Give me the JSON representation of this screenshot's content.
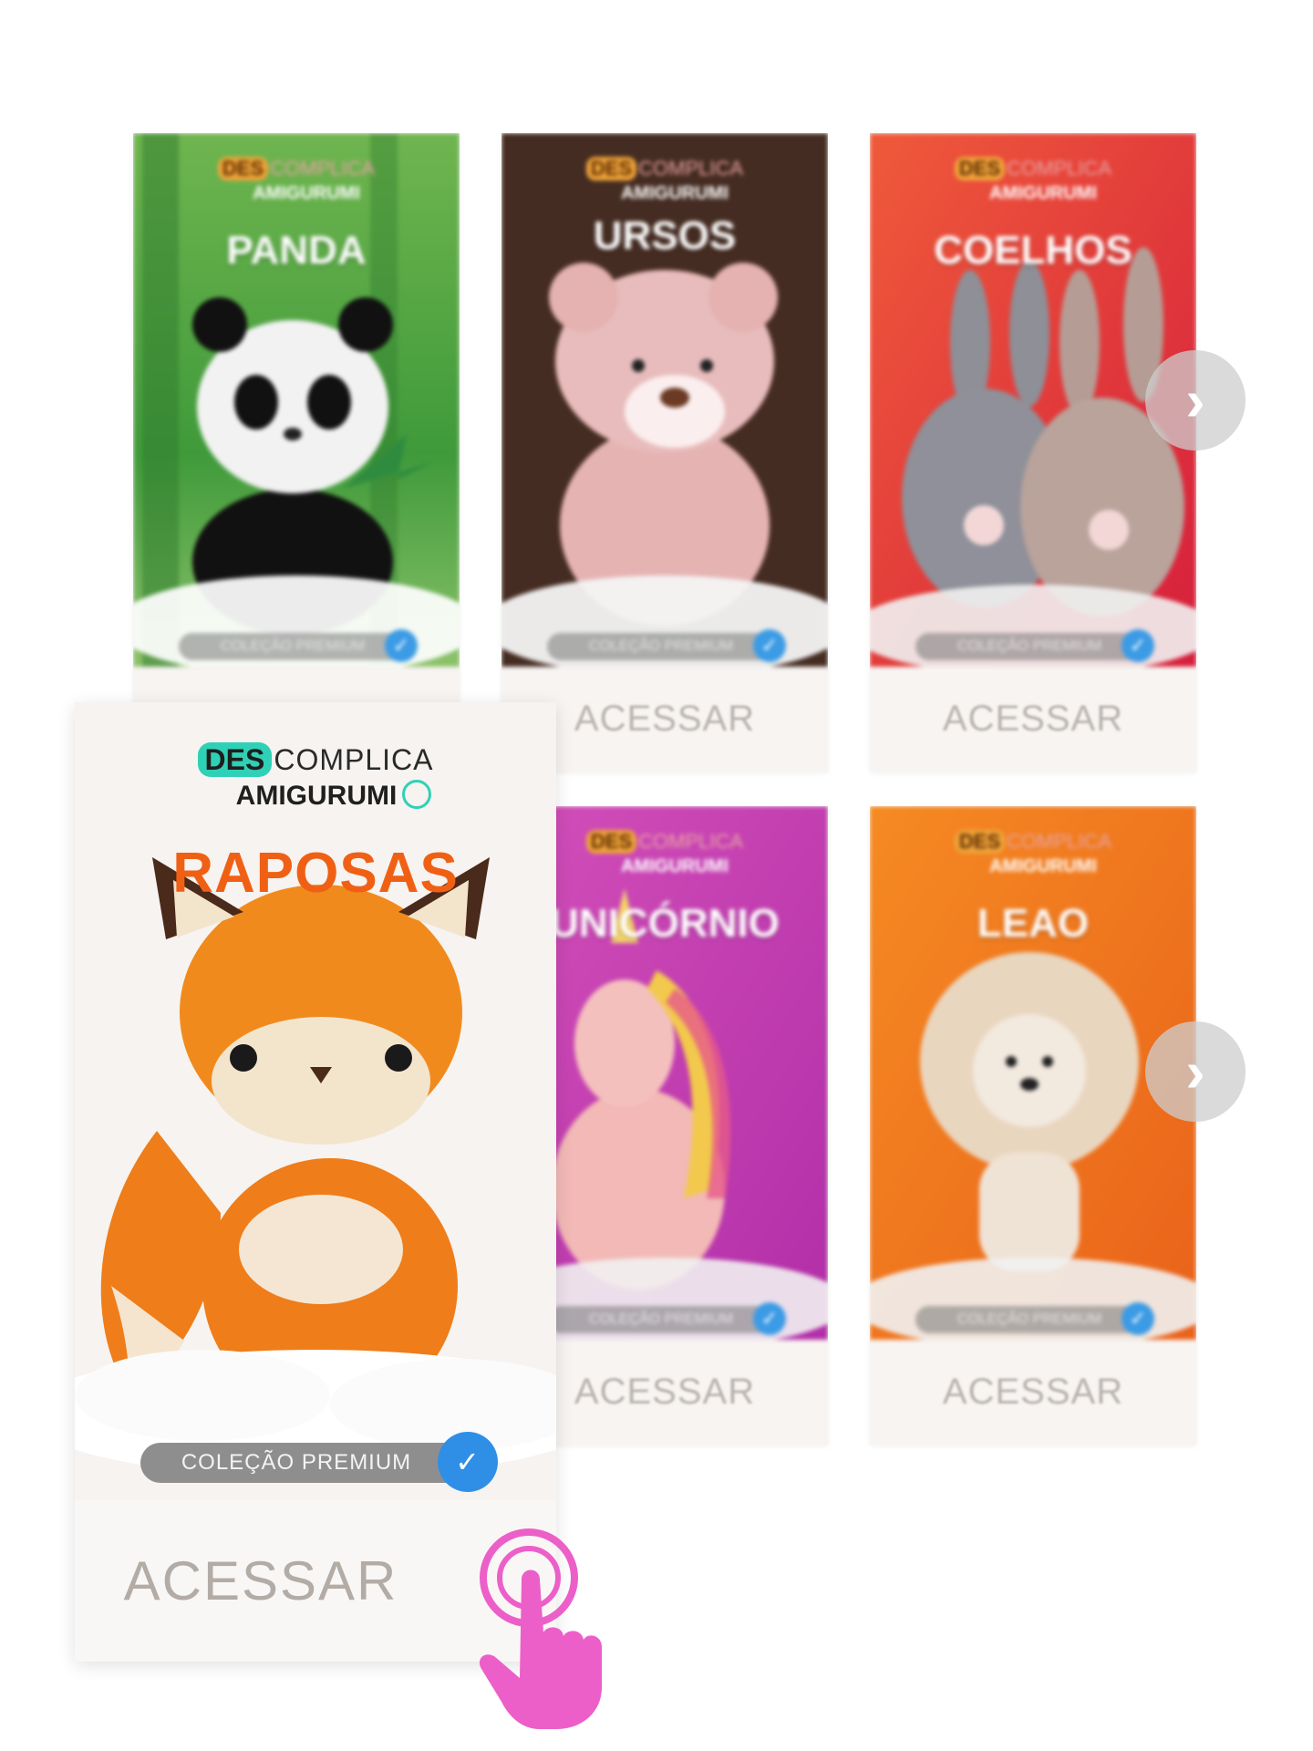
{
  "brand": {
    "des": "DES",
    "complica": "COMPLICA",
    "amigurumi": "AMIGURUMI"
  },
  "collection_badge": "COLEÇÃO PREMIUM",
  "access_label": "ACESSAR",
  "cards": [
    {
      "title": "PANDA",
      "bg": "#4f9a38"
    },
    {
      "title": "URSOS",
      "bg": "#3a241c"
    },
    {
      "title": "COELHOS",
      "bg": "#e4333b"
    },
    {
      "title": "UNICÓRNIO",
      "bg": "#c43fbd"
    },
    {
      "title": "LEAO",
      "bg": "#f27a1c"
    }
  ],
  "featured": {
    "title": "RAPOSAS",
    "title_color": "#f06014",
    "accent": "#2fd1b6"
  },
  "arrows": {
    "next_icon": "chevron-right-icon"
  },
  "pointer": {
    "icon": "tap-hand-icon",
    "color": "#ec5fc9"
  }
}
